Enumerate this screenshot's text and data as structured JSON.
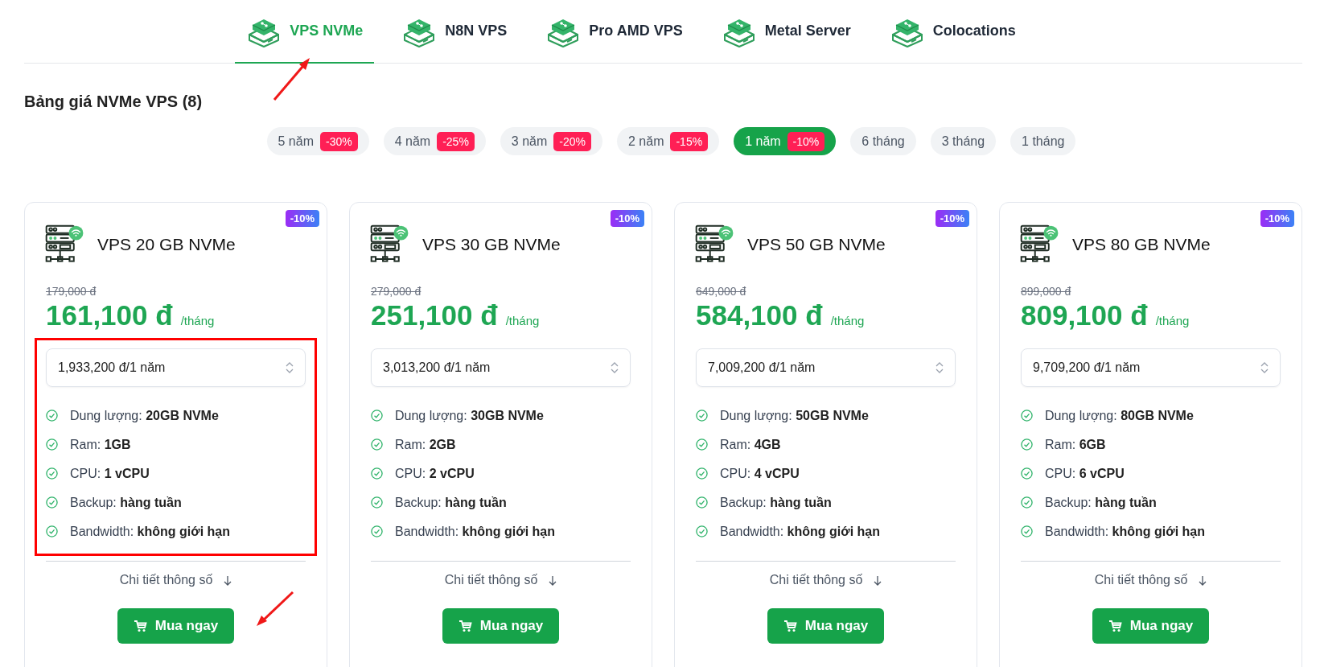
{
  "tabs": [
    {
      "label": "VPS NVMe",
      "selected": true,
      "arrow_mark": true
    },
    {
      "label": "N8N VPS",
      "selected": false,
      "arrow_mark": false
    },
    {
      "label": "Pro AMD VPS",
      "selected": false,
      "arrow_mark": false
    },
    {
      "label": "Metal Server",
      "selected": false,
      "arrow_mark": false
    },
    {
      "label": "Colocations",
      "selected": false,
      "arrow_mark": false
    }
  ],
  "heading": "Bảng giá NVMe VPS (8)",
  "periods": [
    {
      "label": "5 năm",
      "discount": "-30%",
      "selected": false
    },
    {
      "label": "4 năm",
      "discount": "-25%",
      "selected": false
    },
    {
      "label": "3 năm",
      "discount": "-20%",
      "selected": false
    },
    {
      "label": "2 năm",
      "discount": "-15%",
      "selected": false
    },
    {
      "label": "1 năm",
      "discount": "-10%",
      "selected": true
    },
    {
      "label": "6 tháng",
      "selected": false
    },
    {
      "label": "3 tháng",
      "selected": false
    },
    {
      "label": "1 tháng",
      "selected": false
    }
  ],
  "plans": [
    {
      "badge": "-10%",
      "name": "VPS 20 GB NVMe",
      "old_price": "179,000 đ",
      "price": "161,100 đ",
      "unit": "/tháng",
      "billing": "1,933,200 đ/1 năm",
      "features": [
        "Dung lượng: **20GB NVMe**",
        "Ram: **1GB**",
        "CPU: **1 vCPU**",
        "Backup: **hàng tuần**",
        "Bandwidth: **không giới hạn**"
      ],
      "details_link": "Chi tiết thông số",
      "buy_button": "Mua ngay",
      "highlighted": true,
      "buy_arrow": true
    },
    {
      "badge": "-10%",
      "name": "VPS 30 GB NVMe",
      "old_price": "279,000 đ",
      "price": "251,100 đ",
      "unit": "/tháng",
      "billing": "3,013,200 đ/1 năm",
      "features": [
        "Dung lượng: **30GB NVMe**",
        "Ram: **2GB**",
        "CPU: **2 vCPU**",
        "Backup: **hàng tuần**",
        "Bandwidth: **không giới hạn**"
      ],
      "details_link": "Chi tiết thông số",
      "buy_button": "Mua ngay",
      "highlighted": false,
      "buy_arrow": false
    },
    {
      "badge": "-10%",
      "name": "VPS 50 GB NVMe",
      "old_price": "649,000 đ",
      "price": "584,100 đ",
      "unit": "/tháng",
      "billing": "7,009,200 đ/1 năm",
      "features": [
        "Dung lượng: **50GB NVMe**",
        "Ram: **4GB**",
        "CPU: **4 vCPU**",
        "Backup: **hàng tuần**",
        "Bandwidth: **không giới hạn**"
      ],
      "details_link": "Chi tiết thông số",
      "buy_button": "Mua ngay",
      "highlighted": false,
      "buy_arrow": false
    },
    {
      "badge": "-10%",
      "name": "VPS 80 GB NVMe",
      "old_price": "899,000 đ",
      "price": "809,100 đ",
      "unit": "/tháng",
      "billing": "9,709,200 đ/1 năm",
      "features": [
        "Dung lượng: **80GB NVMe**",
        "Ram: **6GB**",
        "CPU: **6 vCPU**",
        "Backup: **hàng tuần**",
        "Bandwidth: **không giới hạn**"
      ],
      "details_link": "Chi tiết thông số",
      "buy_button": "Mua ngay",
      "highlighted": false,
      "buy_arrow": false
    }
  ]
}
